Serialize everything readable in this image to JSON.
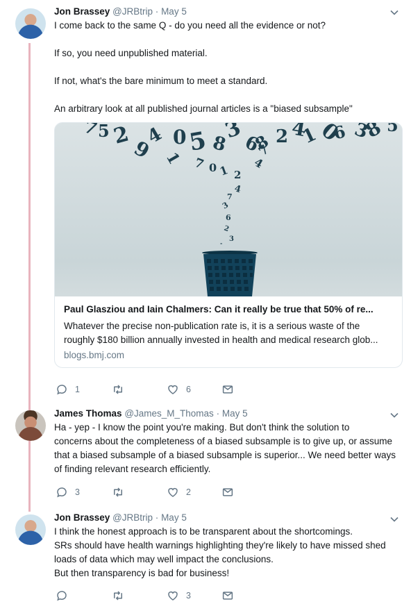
{
  "tweets": [
    {
      "name": "Jon Brassey",
      "handle": "@JRBtrip",
      "dot": "·",
      "date": "May 5",
      "lines": [
        "I come back to the same Q - do you need all the evidence or not?",
        "",
        "If so, you need unpublished material.",
        "",
        "If not, what's the bare minimum to meet a standard.",
        "",
        "An arbitrary look at all published journal articles is a \"biased subsample\""
      ],
      "card": {
        "title": "Paul Glasziou and Iain Chalmers: Can it really be true that 50% of re...",
        "desc_line1": "Whatever the precise non-publication rate is, it is a serious waste of the",
        "desc_line2": "roughly $180 billion annually invested in health and medical research glob...",
        "domain": "blogs.bmj.com"
      },
      "replies": "1",
      "retweets": "",
      "likes": "6"
    },
    {
      "name": "James Thomas",
      "handle": "@James_M_Thomas",
      "dot": "·",
      "date": "May 5",
      "lines": [
        "Ha - yep - I know the point you're making. But don't think the solution to",
        "concerns about the completeness of a biased subsample is to give up, or assume",
        "that a biased subsample of a biased subsample is superior... We need better ways",
        "of finding relevant research efficiently."
      ],
      "replies": "3",
      "retweets": "",
      "likes": "2"
    },
    {
      "name": "Jon Brassey",
      "handle": "@JRBtrip",
      "dot": "·",
      "date": "May 5",
      "lines": [
        "I think the honest approach is to be transparent about the shortcomings.",
        "SRs should have health warnings highlighting they're likely to have missed shed",
        "loads of data which may well impact the conclusions.",
        "But then transparency is bad for business!"
      ],
      "replies": "",
      "retweets": "",
      "likes": "3"
    }
  ],
  "icons": [
    "reply-icon",
    "retweet-icon",
    "like-icon",
    "message-icon",
    "chevron-down-icon"
  ],
  "colors": {
    "thread_line": "#e8b4be",
    "muted": "#657786",
    "text": "#14171a",
    "border": "#e1e8ed"
  }
}
